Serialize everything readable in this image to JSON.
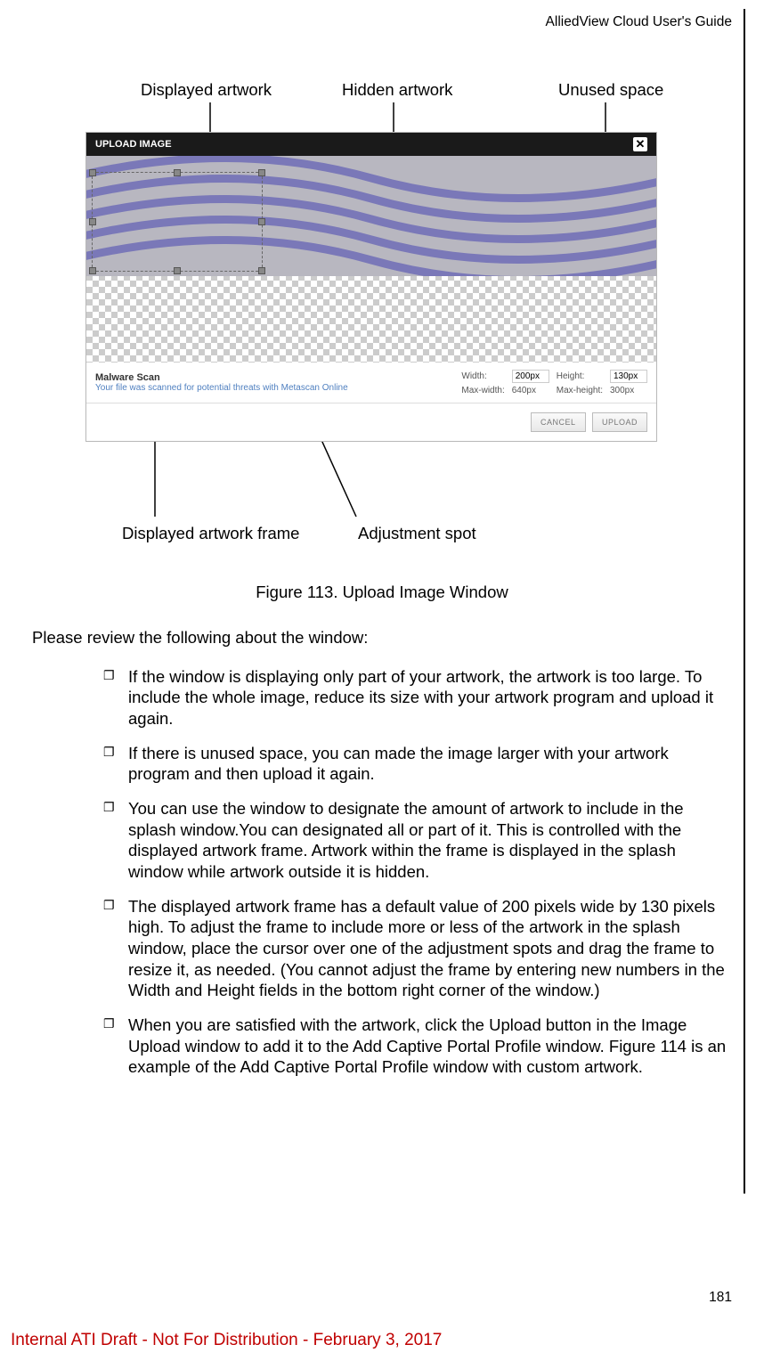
{
  "header": {
    "title": "AlliedView Cloud User's Guide"
  },
  "annotations": {
    "displayed_artwork": "Displayed artwork",
    "hidden_artwork": "Hidden artwork",
    "unused_space": "Unused space",
    "displayed_frame": "Displayed artwork frame",
    "adjustment_spot": "Adjustment spot"
  },
  "upload_window": {
    "title": "UPLOAD IMAGE",
    "malware_title": "Malware Scan",
    "malware_sub": "Your file was scanned for potential threats with Metascan Online",
    "width_label": "Width:",
    "width_value": "200px",
    "height_label": "Height:",
    "height_value": "130px",
    "maxwidth_label": "Max-width:",
    "maxwidth_value": "640px",
    "maxheight_label": "Max-height:",
    "maxheight_value": "300px",
    "cancel": "CANCEL",
    "upload": "UPLOAD"
  },
  "figure_caption": "Figure 113. Upload Image Window",
  "body": {
    "intro": "Please review the following about the window:",
    "bullets": [
      "If the window is displaying only part of your artwork, the artwork is too large. To include the whole image, reduce its size with your artwork program and upload it again.",
      "If there is unused space, you can made the image larger with your artwork program and then upload it again.",
      "You can use the window to designate the amount of artwork to include in the splash window.You can designated all or part of it. This is controlled with the displayed artwork frame. Artwork within the frame is displayed in the splash window while artwork outside it is hidden.",
      "The displayed artwork frame has a default value of 200 pixels wide by 130 pixels high. To adjust the frame to include more or less of the artwork in the splash window, place the cursor over one of the adjustment spots and drag the frame to resize it, as needed. (You cannot adjust the frame by entering new numbers in the Width and Height fields in the bottom right corner of the window.)",
      "When you are satisfied with the artwork, click the Upload button in the Image Upload window to add it to the Add Captive Portal Profile window. Figure 114 is an example of the Add Captive Portal Profile window with custom artwork."
    ]
  },
  "page_number": "181",
  "footer": "Internal ATI Draft - Not For Distribution - February 3, 2017"
}
